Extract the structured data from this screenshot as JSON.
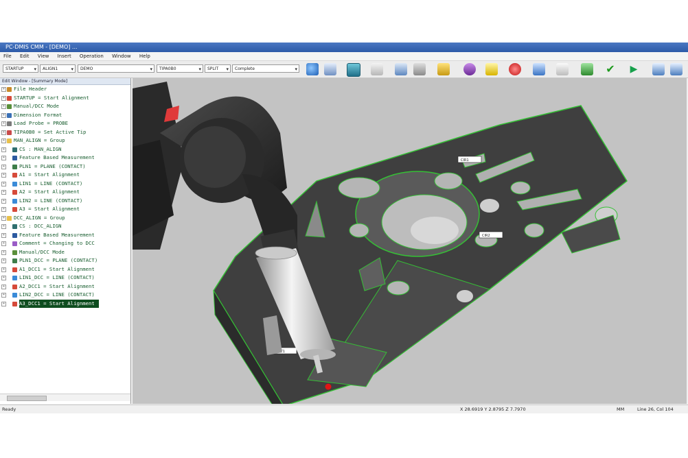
{
  "window": {
    "title": "PC-DMIS CMM - [DEMO] ..."
  },
  "menu": [
    "File",
    "Edit",
    "View",
    "Insert",
    "Operation",
    "Window",
    "Help"
  ],
  "toolbar": {
    "combos": [
      "STARTUP",
      "ALIGN1",
      "DEMO",
      "TIPA0B0",
      "SPLIT",
      "Complete"
    ]
  },
  "tree": {
    "header": "Edit Window - [Summary Mode]",
    "items": [
      {
        "label": "File Header",
        "level": 1,
        "icon": "file-icon"
      },
      {
        "label": "STARTUP = Start Alignment",
        "level": 1,
        "icon": "alignment-icon"
      },
      {
        "label": "Manual/DCC Mode",
        "level": 1,
        "icon": "mode-icon"
      },
      {
        "label": "Dimension Format",
        "level": 1,
        "icon": "format-icon"
      },
      {
        "label": "Load Probe = PROBE",
        "level": 1,
        "icon": "probe-icon"
      },
      {
        "label": "TIPA0B0 = Set Active Tip",
        "level": 1,
        "icon": "tip-icon"
      },
      {
        "label": "MAN_ALIGN = Group",
        "level": 1,
        "icon": "group-icon"
      },
      {
        "label": "CS : MAN_ALIGN",
        "level": 2,
        "icon": "cs-icon"
      },
      {
        "label": "Feature Based Measurement",
        "level": 2,
        "icon": "feature-icon"
      },
      {
        "label": "PLN1 = PLANE (CONTACT)",
        "level": 2,
        "icon": "plane-icon"
      },
      {
        "label": "A1 = Start Alignment",
        "level": 2,
        "icon": "alignment-icon"
      },
      {
        "label": "LIN1 = LINE (CONTACT)",
        "level": 2,
        "icon": "line-icon"
      },
      {
        "label": "A2 = Start Alignment",
        "level": 2,
        "icon": "alignment-icon"
      },
      {
        "label": "LIN2 = LINE (CONTACT)",
        "level": 2,
        "icon": "line-icon"
      },
      {
        "label": "A3 = Start Alignment",
        "level": 2,
        "icon": "alignment-icon"
      },
      {
        "label": "DCC_ALIGN = Group",
        "level": 1,
        "icon": "group-icon"
      },
      {
        "label": "CS : DCC_ALIGN",
        "level": 2,
        "icon": "cs-icon"
      },
      {
        "label": "Feature Based Measurement",
        "level": 2,
        "icon": "feature-icon"
      },
      {
        "label": "Comment = Changing to DCC",
        "level": 2,
        "icon": "comment-icon"
      },
      {
        "label": "Manual/DCC Mode",
        "level": 2,
        "icon": "mode-icon"
      },
      {
        "label": "PLN1_DCC = PLANE (CONTACT)",
        "level": 2,
        "icon": "plane-icon"
      },
      {
        "label": "A1_DCC1 = Start Alignment",
        "level": 2,
        "icon": "alignment-icon"
      },
      {
        "label": "LIN1_DCC = LINE (CONTACT)",
        "level": 2,
        "icon": "line-icon"
      },
      {
        "label": "A2_DCC1 = Start Alignment",
        "level": 2,
        "icon": "alignment-icon"
      },
      {
        "label": "LIN2_DCC = LINE (CONTACT)",
        "level": 2,
        "icon": "line-icon"
      },
      {
        "label": "A3_DCC1 = Start Alignment",
        "level": 2,
        "icon": "alignment-icon",
        "selected": true
      }
    ]
  },
  "viewport": {
    "callouts": [
      "CIR1",
      "CIR2",
      "PNT1"
    ],
    "colors": {
      "background": "#c3c3c3",
      "part": "#454545",
      "edge": "#3fbf3f",
      "probe_body": "#d9d9d9",
      "probe_head": "#2e2e2e",
      "stylus_tip": "#e01515"
    }
  },
  "status": {
    "left": "Ready",
    "coords": "X 28.6919  Y 2.8795  Z 7.7970",
    "units": "MM",
    "position": "Line 26, Col 104"
  }
}
